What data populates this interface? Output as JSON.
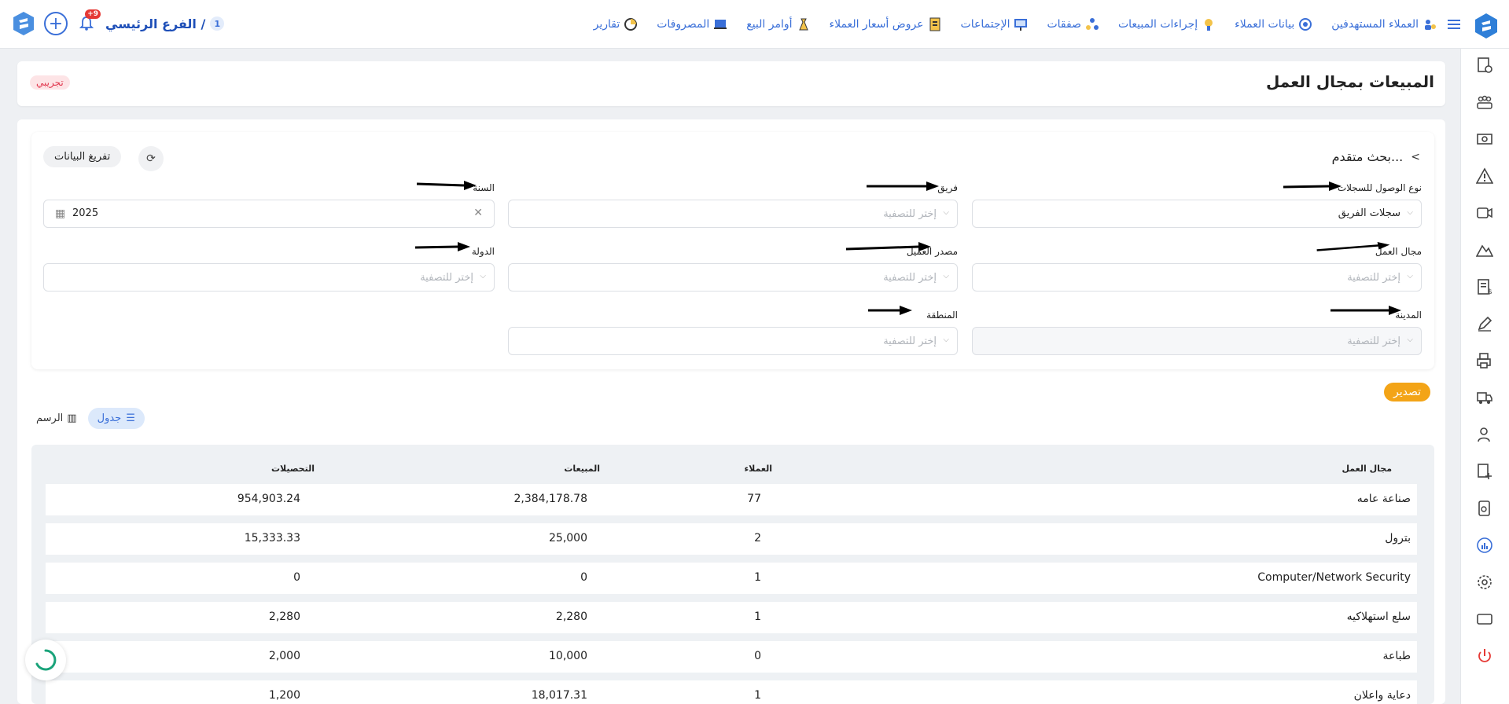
{
  "header": {
    "branch_label": "الفرع الرئيسي /",
    "branch_number": "1",
    "notification_count": "+9",
    "nav": [
      {
        "label": "العملاء المستهدفين",
        "icon": "targeted-clients-icon"
      },
      {
        "label": "بيانات العملاء",
        "icon": "client-data-icon"
      },
      {
        "label": "إجراءات المبيعات",
        "icon": "sales-actions-icon"
      },
      {
        "label": "صفقات",
        "icon": "deals-icon"
      },
      {
        "label": "الإجتماعات",
        "icon": "meetings-icon"
      },
      {
        "label": "عروض أسعار العملاء",
        "icon": "quotes-icon"
      },
      {
        "label": "أوامر البيع",
        "icon": "sales-orders-icon"
      },
      {
        "label": "المصروفات",
        "icon": "expenses-icon"
      },
      {
        "label": "تقارير",
        "icon": "reports-icon"
      }
    ]
  },
  "page": {
    "title": "المبيعات بمجال العمل",
    "tag": "تجريبي"
  },
  "filters": {
    "advanced_search_label": "بحث متقدم...",
    "clear_button": "تفريغ البيانات",
    "placeholder": "إختر للتصفية",
    "fields": {
      "access_type": {
        "label": "نوع الوصول للسجلات",
        "value": "سجلات الفريق"
      },
      "team": {
        "label": "فريق"
      },
      "year": {
        "label": "السنة",
        "value": "2025"
      },
      "business_field": {
        "label": "مجال العمل"
      },
      "client_source": {
        "label": "مصدر العميل"
      },
      "country": {
        "label": "الدولة"
      },
      "city": {
        "label": "المدينة"
      },
      "region": {
        "label": "المنطقة"
      }
    }
  },
  "actions": {
    "export": "تصدير",
    "view_table": "جدول",
    "view_chart": "الرسم"
  },
  "table": {
    "headers": {
      "field": "مجال العمل",
      "clients": "العملاء",
      "sales": "المبيعات",
      "collections": "التحصيلات"
    },
    "rows": [
      {
        "field": "صناعة عامه",
        "clients": "77",
        "sales": "2,384,178.78",
        "collections": "954,903.24"
      },
      {
        "field": "بترول",
        "clients": "2",
        "sales": "25,000",
        "collections": "15,333.33"
      },
      {
        "field": "Computer/Network Security",
        "clients": "1",
        "sales": "0",
        "collections": "0"
      },
      {
        "field": "سلع استهلاكيه",
        "clients": "1",
        "sales": "2,280",
        "collections": "2,280"
      },
      {
        "field": "طباعة",
        "clients": "0",
        "sales": "10,000",
        "collections": "2,000"
      },
      {
        "field": "دعاية واعلان",
        "clients": "1",
        "sales": "18,017.31",
        "collections": "1,200"
      }
    ]
  },
  "colors": {
    "accent": "#3a6fd8",
    "export": "#f3a417",
    "tag_bg": "#fde4e6",
    "tag_text": "#e0344b"
  }
}
